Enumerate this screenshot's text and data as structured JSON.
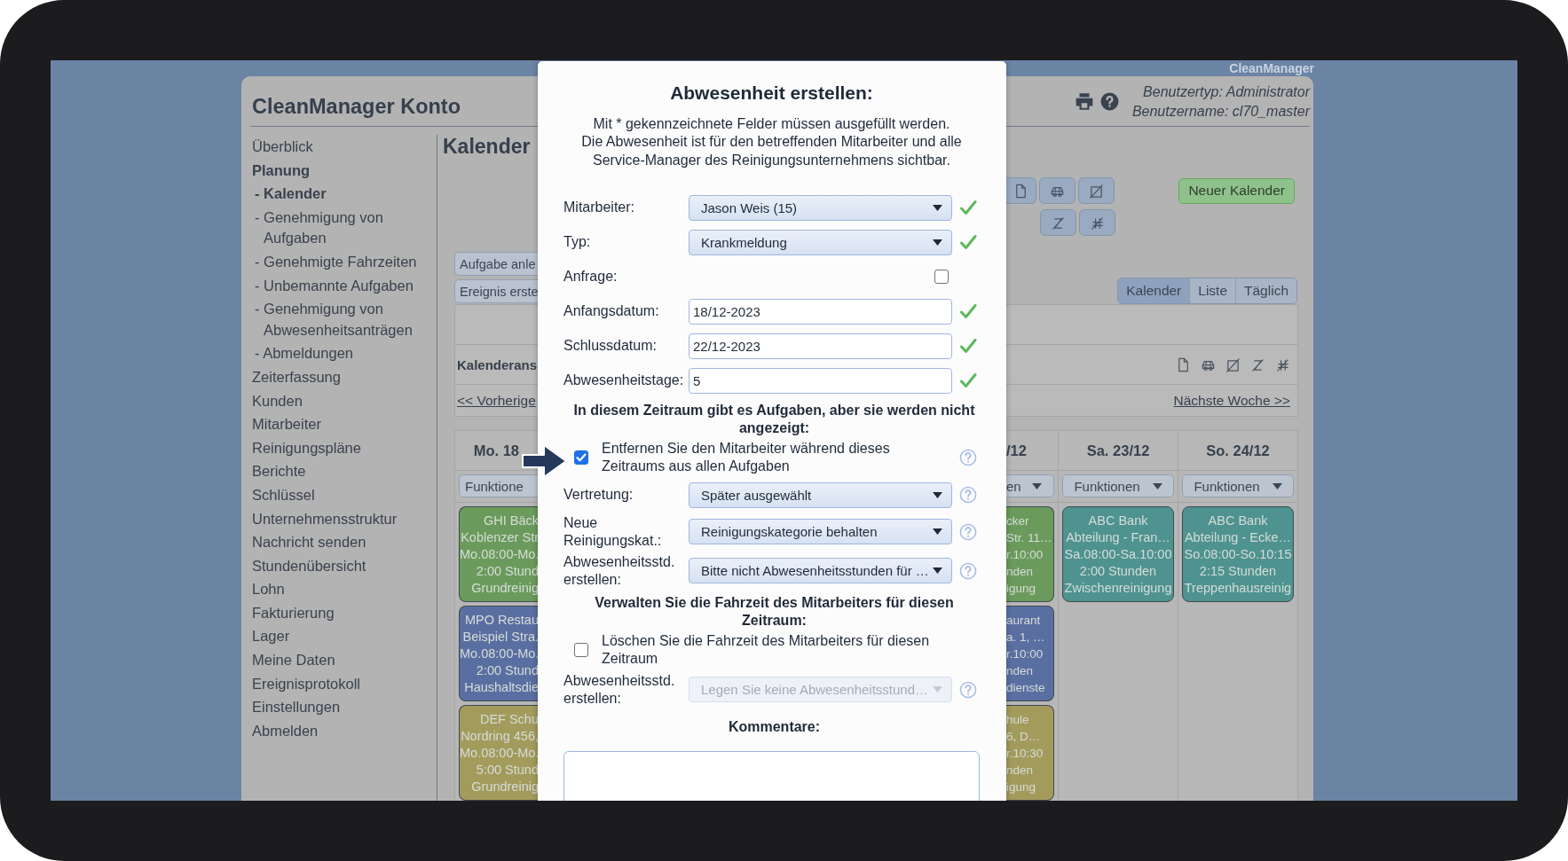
{
  "app_label": "CleanManager",
  "header": {
    "title": "CleanManager Konto",
    "user_type": "Benutzertyp: Administrator",
    "user_name": "Benutzername: cl70_master"
  },
  "sidebar": {
    "items": [
      {
        "label": "Überblick",
        "selected": false
      },
      {
        "label": "Planung",
        "selected": false,
        "children": [
          {
            "label": "- Kalender",
            "selected": true
          },
          {
            "label": "- Genehmigung von Aufgaben",
            "selected": false
          },
          {
            "label": "- Genehmigte Fahrzeiten",
            "selected": false
          },
          {
            "label": "- Unbemannte Aufgaben",
            "selected": false
          },
          {
            "label": "- Genehmigung von Abwesenheitsanträgen",
            "selected": false
          },
          {
            "label": "- Abmeldungen",
            "selected": false
          }
        ]
      },
      {
        "label": "Zeiterfassung",
        "selected": false
      },
      {
        "label": "Kunden",
        "selected": false
      },
      {
        "label": "Mitarbeiter",
        "selected": false
      },
      {
        "label": "Reinigungspläne",
        "selected": false
      },
      {
        "label": "Berichte",
        "selected": false
      },
      {
        "label": "Schlüssel",
        "selected": false
      },
      {
        "label": "Unternehmensstruktur",
        "selected": false
      },
      {
        "label": "Nachricht senden",
        "selected": false
      },
      {
        "label": "Stundenübersicht",
        "selected": false
      },
      {
        "label": "Lohn",
        "selected": false
      },
      {
        "label": "Fakturierung",
        "selected": false
      },
      {
        "label": "Lager",
        "selected": false
      },
      {
        "label": "Meine Daten",
        "selected": false
      },
      {
        "label": "Ereignisprotokoll",
        "selected": false
      },
      {
        "label": "Einstellungen",
        "selected": false
      },
      {
        "label": "Abmelden",
        "selected": false
      }
    ]
  },
  "main": {
    "heading": "Kalender",
    "action_buttons": [
      "Aufgabe anle",
      "Ereignis erste"
    ],
    "new_calendar_button": "Neuer Kalender",
    "view_tabs": [
      {
        "label": "Kalender",
        "selected": true
      },
      {
        "label": "Liste",
        "selected": false
      },
      {
        "label": "Täglich",
        "selected": false
      }
    ],
    "calendar_view_label": "Kalenderans",
    "prev_link": "<< Vorherige",
    "next_link": "Nächste Woche >>",
    "days_left": [
      {
        "header": "Mo. 18",
        "functions": "Funktione",
        "caret": false,
        "events": [
          {
            "color": "#6b9b5c",
            "lines": [
              "GHI Bäck",
              "Koblenzer Str",
              "Mo.08:00-Mo.",
              "2:00 Stund",
              "Grundreinig"
            ]
          },
          {
            "color": "#5a6fa1",
            "lines": [
              "MPO Restau",
              "Beispiel Stra.",
              "Mo.08:00-Mo.",
              "2:00 Stund",
              "Haushaltsdie"
            ]
          },
          {
            "color": "#a39b5c",
            "lines": [
              "DEF Schu",
              "Nordring 456,",
              "Mo.08:00-Mo.",
              "5:00 Stund",
              "Grundreinig"
            ]
          }
        ]
      }
    ],
    "days_right": [
      {
        "header": "/12",
        "functions": "en",
        "caret": true,
        "events": [
          {
            "color": "#6b9b5c",
            "lines": [
              "cker",
              "Str. 11…",
              "r.10:00",
              "nden",
              "igung"
            ]
          },
          {
            "color": "#5a6fa1",
            "lines": [
              "aurant",
              "a. 1, …",
              "r.10:00",
              "nden",
              "dienste"
            ]
          },
          {
            "color": "#a39b5c",
            "lines": [
              "hule",
              "6, D…",
              "r.10:30",
              "nden",
              "igung"
            ]
          }
        ]
      },
      {
        "header": "Sa. 23/12",
        "functions": "Funktionen",
        "caret": true,
        "events": [
          {
            "color": "#4e9390",
            "lines": [
              "ABC Bank",
              "Abteilung - Fran…",
              "Sa.08:00-Sa.10:00",
              "2:00 Stunden",
              "Zwischenreinigung"
            ]
          }
        ]
      },
      {
        "header": "So. 24/12",
        "functions": "Funktionen",
        "caret": true,
        "events": [
          {
            "color": "#4e9390",
            "lines": [
              "ABC Bank",
              "Abteilung - Ecke…",
              "So.08:00-So.10:15",
              "2:15 Stunden",
              "Treppenhausreinig"
            ]
          }
        ]
      }
    ]
  },
  "dialog": {
    "title": "Abwesenheit erstellen:",
    "notes": [
      "Mit * gekennzeichnete Felder müssen ausgefüllt werden.",
      "Die Abwesenheit ist für den betreffenden Mitarbeiter und alle Service-Manager des Reinigungsunternehmens sichtbar."
    ],
    "rows": [
      {
        "kind": "select",
        "label": "Mitarbeiter:",
        "value": "Jason Weis (15)",
        "disabled": false,
        "valid": true
      },
      {
        "kind": "select",
        "label": "Typ:",
        "value": "Krankmeldung",
        "disabled": false,
        "valid": true
      },
      {
        "kind": "checkbox",
        "label": "Anfrage:",
        "checked": false
      },
      {
        "kind": "input",
        "label": "Anfangsdatum:",
        "value": "18/12-2023",
        "valid": true
      },
      {
        "kind": "input",
        "label": "Schlussdatum:",
        "value": "22/12-2023",
        "valid": true
      },
      {
        "kind": "input",
        "label": "Abwesenheitstage:",
        "value": "5",
        "valid": true
      },
      {
        "kind": "heading",
        "text": "In diesem Zeitraum gibt es Aufgaben, aber sie werden nicht angezeigt:"
      },
      {
        "kind": "option",
        "text": "Entfernen Sie den Mitarbeiter während dieses Zeitraums aus allen Aufgaben",
        "checked": true,
        "help": true
      },
      {
        "kind": "select",
        "label": "Vertretung:",
        "value": "Später ausgewählt",
        "disabled": false,
        "valid": false,
        "help": true
      },
      {
        "kind": "select",
        "label": "Neue Reinigungskat.:",
        "value": "Reinigungskategorie behalten",
        "disabled": false,
        "valid": false,
        "help": true
      },
      {
        "kind": "select",
        "label": "Abwesenheitsstd. erstellen:",
        "value": "Bitte nicht Abwesenheitsstunden für …",
        "disabled": false,
        "valid": false,
        "help": true
      },
      {
        "kind": "heading",
        "text": "Verwalten Sie die Fahrzeit des Mitarbeiters für diesen Zeitraum:"
      },
      {
        "kind": "option",
        "text": "Löschen Sie die Fahrzeit des Mitarbeiters für diesen Zeitraum",
        "checked": false,
        "help": false
      },
      {
        "kind": "select",
        "label": "Abwesenheitsstd. erstellen:",
        "value": "Legen Sie keine Abwesenheitsstund…",
        "disabled": true,
        "valid": false,
        "help": true
      },
      {
        "kind": "heading",
        "text": "Kommentare:"
      },
      {
        "kind": "textarea"
      }
    ]
  }
}
